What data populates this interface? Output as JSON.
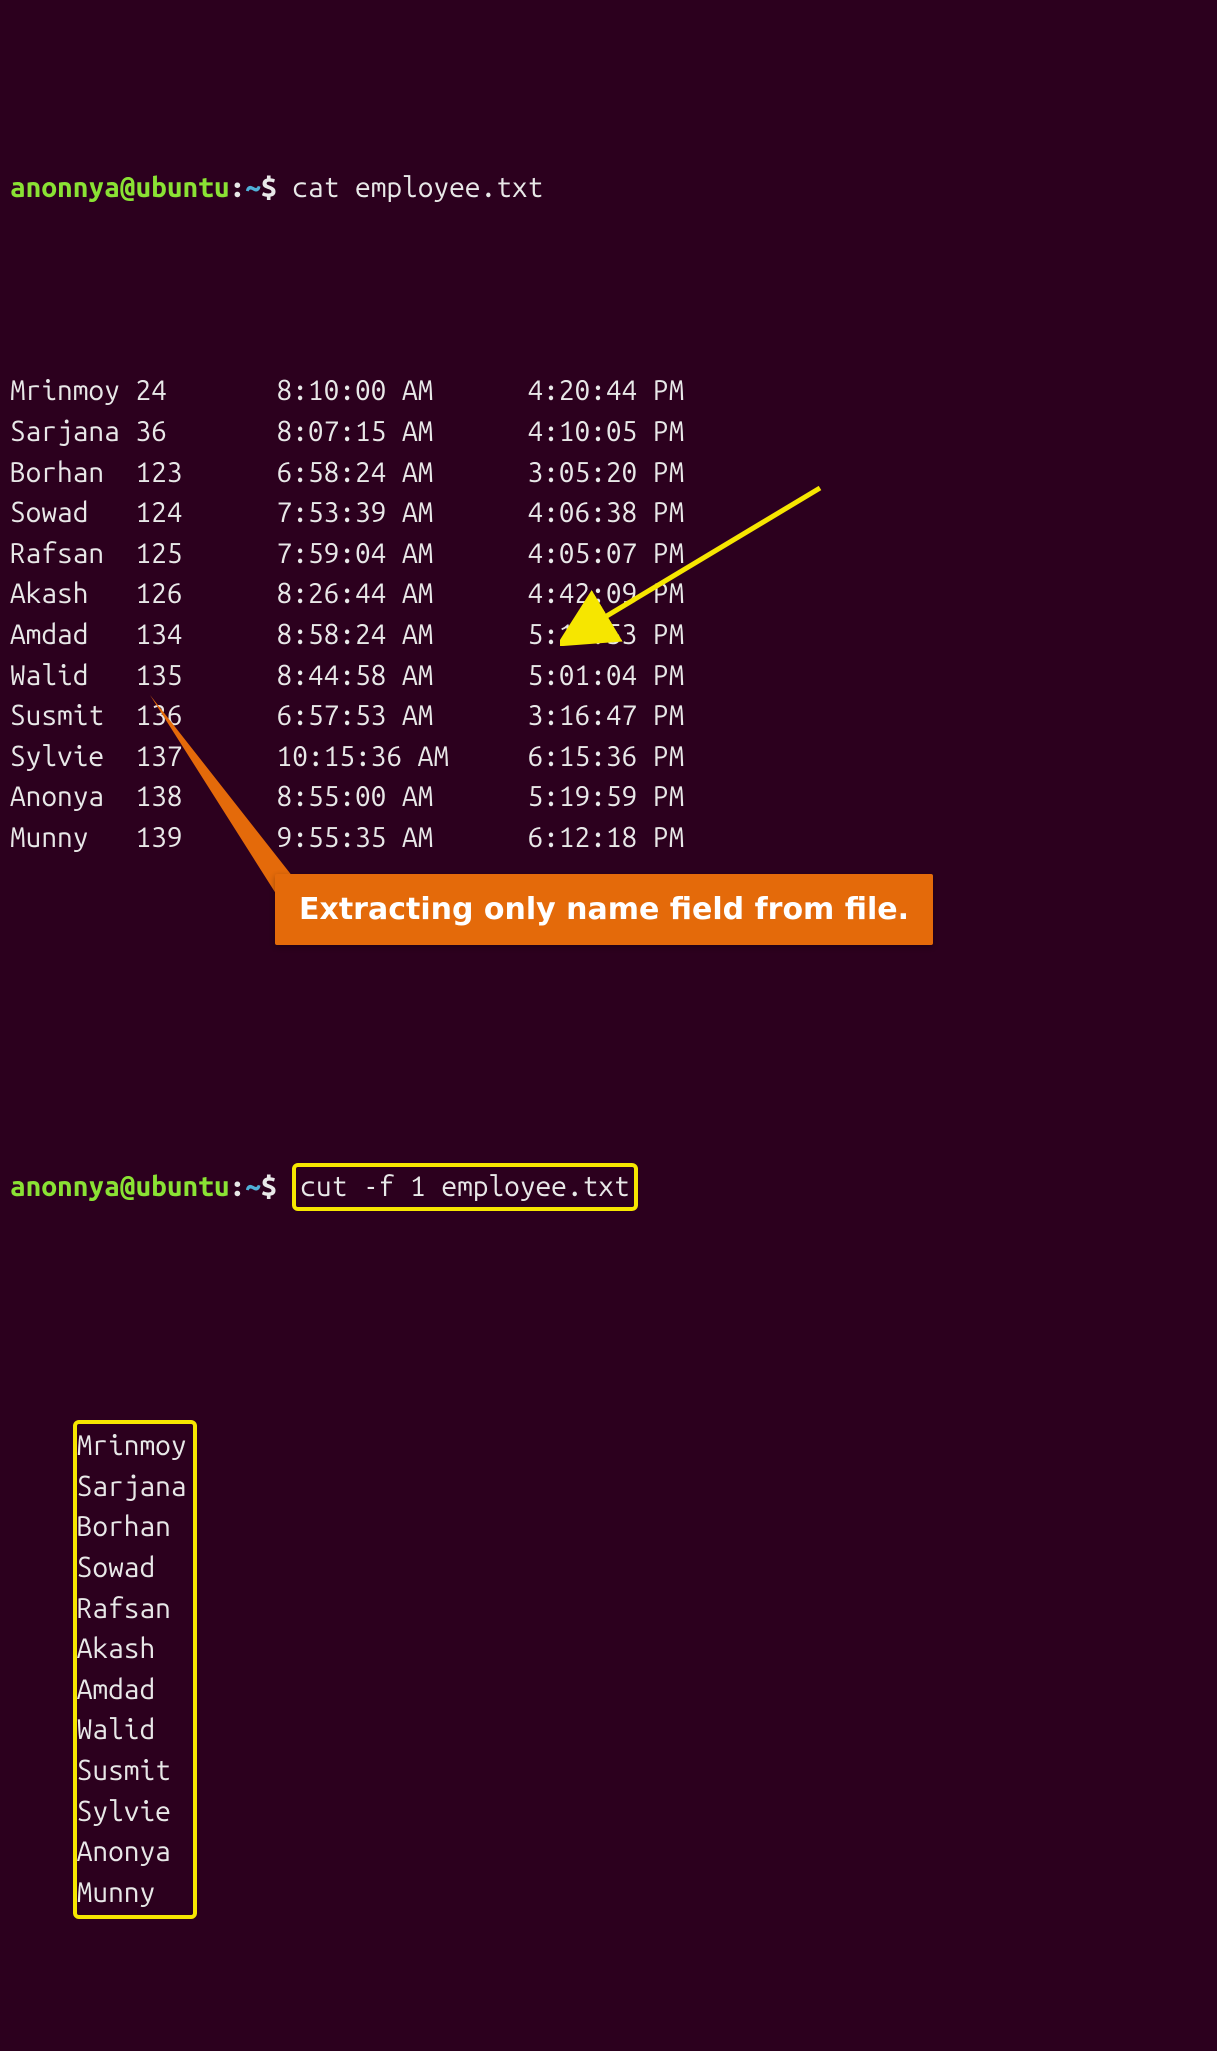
{
  "prompt1": {
    "user": "anonnya",
    "at": "@",
    "host": "ubuntu",
    "colon": ":",
    "path": "~",
    "dollar": "$",
    "command": "cat employee.txt"
  },
  "table": {
    "rows": [
      {
        "name": "Mrinmoy",
        "id": "24",
        "time_in": "8:10:00 AM",
        "time_out": "4:20:44 PM"
      },
      {
        "name": "Sarjana",
        "id": "36",
        "time_in": "8:07:15 AM",
        "time_out": "4:10:05 PM"
      },
      {
        "name": "Borhan",
        "id": "123",
        "time_in": "6:58:24 AM",
        "time_out": "3:05:20 PM"
      },
      {
        "name": "Sowad",
        "id": "124",
        "time_in": "7:53:39 AM",
        "time_out": "4:06:38 PM"
      },
      {
        "name": "Rafsan",
        "id": "125",
        "time_in": "7:59:04 AM",
        "time_out": "4:05:07 PM"
      },
      {
        "name": "Akash",
        "id": "126",
        "time_in": "8:26:44 AM",
        "time_out": "4:42:09 PM"
      },
      {
        "name": "Amdad",
        "id": "134",
        "time_in": "8:58:24 AM",
        "time_out": "5:17:53 PM"
      },
      {
        "name": "Walid",
        "id": "135",
        "time_in": "8:44:58 AM",
        "time_out": "5:01:04 PM"
      },
      {
        "name": "Susmit",
        "id": "136",
        "time_in": "6:57:53 AM",
        "time_out": "3:16:47 PM"
      },
      {
        "name": "Sylvie",
        "id": "137",
        "time_in": "10:15:36 AM",
        "time_out": "6:15:36 PM"
      },
      {
        "name": "Anonya",
        "id": "138",
        "time_in": "8:55:00 AM",
        "time_out": "5:19:59 PM"
      },
      {
        "name": "Munny",
        "id": "139",
        "time_in": "9:55:35 AM",
        "time_out": "6:12:18 PM"
      }
    ]
  },
  "prompt2": {
    "user": "anonnya",
    "at": "@",
    "host": "ubuntu",
    "colon": ":",
    "path": "~",
    "dollar": "$",
    "command": "cut -f 1 employee.txt"
  },
  "names": [
    "Mrinmoy",
    "Sarjana",
    "Borhan",
    "Sowad",
    "Rafsan",
    "Akash",
    "Amdad",
    "Walid",
    "Susmit",
    "Sylvie",
    "Anonya",
    "Munny"
  ],
  "callout_text": "Extracting only name field from file.",
  "colors": {
    "bg": "#2c001e",
    "fg": "#e8e8e8",
    "user": "#8ae234",
    "path": "#4fb0d7",
    "highlight": "#f6e600",
    "callout_bg": "#e46a0a",
    "callout_fg": "#ffffff"
  }
}
